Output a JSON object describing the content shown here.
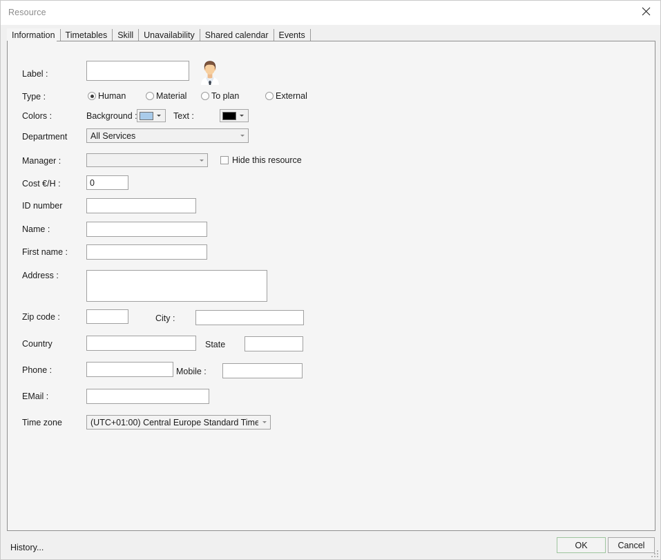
{
  "window": {
    "title": "Resource",
    "close_icon": "close-icon"
  },
  "tabs": [
    {
      "label": "Information",
      "active": true
    },
    {
      "label": "Timetables",
      "active": false
    },
    {
      "label": "Skill",
      "active": false
    },
    {
      "label": "Unavailability",
      "active": false
    },
    {
      "label": "Shared calendar",
      "active": false
    },
    {
      "label": "Events",
      "active": false
    }
  ],
  "form": {
    "label": {
      "label": "Label :",
      "value": "",
      "placeholder": ""
    },
    "avatar": {
      "icon": "person-avatar-icon"
    },
    "type": {
      "label": "Type :",
      "options": [
        {
          "label": "Human",
          "selected": true
        },
        {
          "label": "Material",
          "selected": false
        },
        {
          "label": "To plan",
          "selected": false
        },
        {
          "label": "External",
          "selected": false
        }
      ]
    },
    "colors": {
      "label": "Colors :",
      "background": {
        "label": "Background :",
        "value": "#a9cbea"
      },
      "text": {
        "label": "Text :",
        "value": "#000000"
      }
    },
    "department": {
      "label": "Department",
      "value": "All Services"
    },
    "manager": {
      "label": "Manager :",
      "value": ""
    },
    "hide_resource": {
      "label": "Hide this resource",
      "checked": false
    },
    "cost": {
      "label": "Cost €/H :",
      "value": "0"
    },
    "id_number": {
      "label": "ID number",
      "value": ""
    },
    "name": {
      "label": "Name :",
      "value": ""
    },
    "first_name": {
      "label": "First name :",
      "value": ""
    },
    "address": {
      "label": "Address :",
      "value": ""
    },
    "zip_code": {
      "label": "Zip code :",
      "value": ""
    },
    "city": {
      "label": "City :",
      "value": ""
    },
    "country": {
      "label": "Country",
      "value": ""
    },
    "state": {
      "label": "State",
      "value": ""
    },
    "phone": {
      "label": "Phone :",
      "value": ""
    },
    "mobile": {
      "label": "Mobile :",
      "value": ""
    },
    "email": {
      "label": "EMail :",
      "value": ""
    },
    "time_zone": {
      "label": "Time zone",
      "value": "(UTC+01:00) Central Europe Standard Time"
    }
  },
  "footer": {
    "history": "History...",
    "ok": "OK",
    "cancel": "Cancel"
  }
}
